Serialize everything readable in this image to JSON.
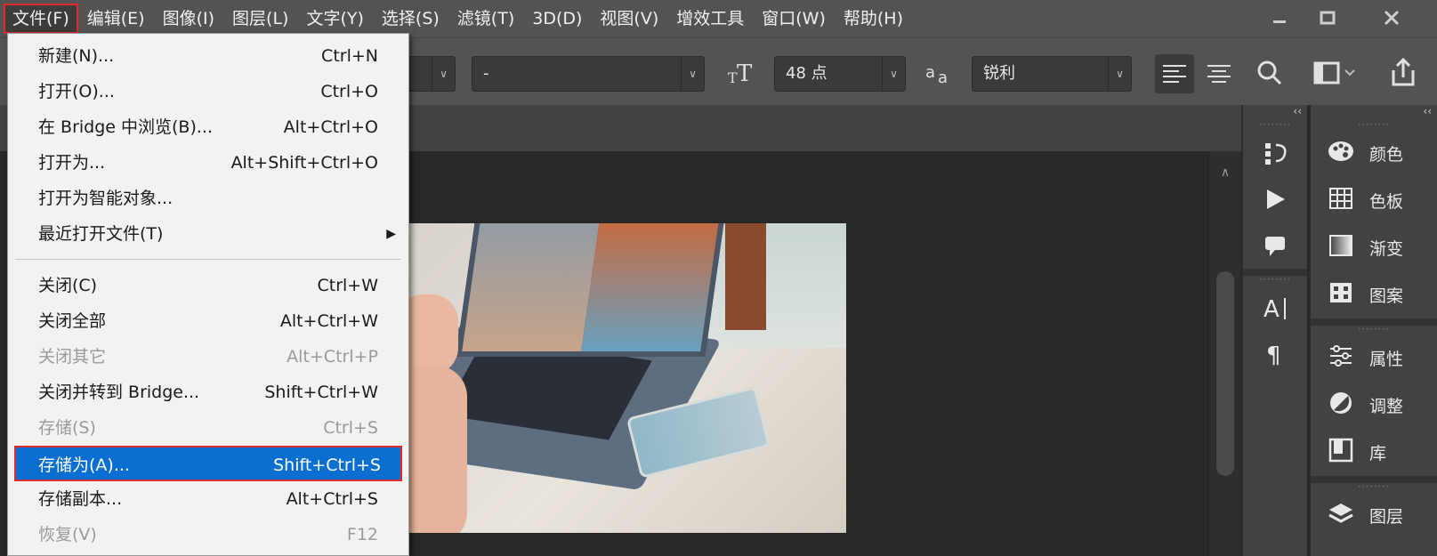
{
  "menubar": {
    "items": [
      "文件(F)",
      "编辑(E)",
      "图像(I)",
      "图层(L)",
      "文字(Y)",
      "选择(S)",
      "滤镜(T)",
      "3D(D)",
      "视图(V)",
      "增效工具",
      "窗口(W)",
      "帮助(H)"
    ],
    "window_controls": [
      "minimize-icon",
      "restore-icon",
      "close-icon"
    ]
  },
  "options": {
    "font_style_value": "-",
    "font_size_value": "48 点",
    "antialias_value": "锐利"
  },
  "file_menu": [
    {
      "label": "新建(N)...",
      "shortcut": "Ctrl+N",
      "disabled": false
    },
    {
      "label": "打开(O)...",
      "shortcut": "Ctrl+O",
      "disabled": false
    },
    {
      "label": "在 Bridge 中浏览(B)...",
      "shortcut": "Alt+Ctrl+O",
      "disabled": false
    },
    {
      "label": "打开为...",
      "shortcut": "Alt+Shift+Ctrl+O",
      "disabled": false
    },
    {
      "label": "打开为智能对象...",
      "shortcut": "",
      "disabled": false
    },
    {
      "label": "最近打开文件(T)",
      "shortcut": "",
      "disabled": false,
      "submenu": true
    },
    {
      "label": "关闭(C)",
      "shortcut": "Ctrl+W",
      "disabled": false
    },
    {
      "label": "关闭全部",
      "shortcut": "Alt+Ctrl+W",
      "disabled": false
    },
    {
      "label": "关闭其它",
      "shortcut": "Alt+Ctrl+P",
      "disabled": true
    },
    {
      "label": "关闭并转到 Bridge...",
      "shortcut": "Shift+Ctrl+W",
      "disabled": false
    },
    {
      "label": "存储(S)",
      "shortcut": "Ctrl+S",
      "disabled": true
    },
    {
      "label": "存储为(A)...",
      "shortcut": "Shift+Ctrl+S",
      "disabled": false,
      "selected": true
    },
    {
      "label": "存储副本...",
      "shortcut": "Alt+Ctrl+S",
      "disabled": false
    },
    {
      "label": "恢复(V)",
      "shortcut": "F12",
      "disabled": true
    }
  ],
  "right_panels": {
    "collapse_glyph": "‹‹",
    "narrow_icons": [
      "history-icon",
      "play-action-icon",
      "comment-icon",
      "character-icon",
      "paragraph-icon"
    ],
    "panel_items": [
      {
        "label": "颜色",
        "icon": "palette-icon"
      },
      {
        "label": "色板",
        "icon": "swatches-grid-icon"
      },
      {
        "label": "渐变",
        "icon": "gradient-icon"
      },
      {
        "label": "图案",
        "icon": "pattern-icon"
      },
      {
        "label": "属性",
        "icon": "properties-sliders-icon"
      },
      {
        "label": "调整",
        "icon": "adjustments-icon"
      },
      {
        "label": "库",
        "icon": "library-icon"
      },
      {
        "label": "图层",
        "icon": "layers-icon"
      }
    ]
  },
  "colors": {
    "menu_bg": "#535353",
    "canvas_bg": "#282828",
    "highlight": "#0a6fd0",
    "annotation_red": "#e02a2a"
  }
}
